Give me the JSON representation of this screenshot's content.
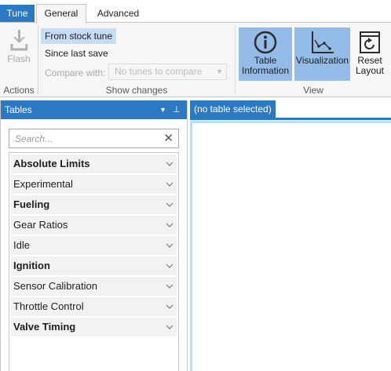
{
  "ribbon": {
    "tabs": {
      "tune": "Tune",
      "general": "General",
      "advanced": "Advanced"
    },
    "actions": {
      "flash_label": "Flash",
      "group_label": "Actions"
    },
    "show_changes": {
      "option_stock": "From stock tune",
      "option_last_save": "Since last save",
      "compare_label": "Compare with:",
      "compare_value": "No tunes to compare",
      "group_label": "Show changes"
    },
    "view": {
      "table_info_line1": "Table",
      "table_info_line2": "Information",
      "visualization": "Visualization",
      "reset_line1": "Reset",
      "reset_line2": "Layout",
      "group_label": "View"
    }
  },
  "tables_panel": {
    "title": "Tables",
    "search_placeholder": "Search...",
    "items": [
      {
        "label": "Absolute Limits",
        "bold": true
      },
      {
        "label": "Experimental",
        "bold": false
      },
      {
        "label": "Fueling",
        "bold": true
      },
      {
        "label": "Gear Ratios",
        "bold": false
      },
      {
        "label": "Idle",
        "bold": false
      },
      {
        "label": "Ignition",
        "bold": true
      },
      {
        "label": "Sensor Calibration",
        "bold": false
      },
      {
        "label": "Throttle Control",
        "bold": false
      },
      {
        "label": "Valve Timing",
        "bold": true
      }
    ]
  },
  "document": {
    "tab_label": "(no table selected)"
  },
  "colors": {
    "accent": "#2b79c2",
    "selection": "#c5dcf3",
    "active_button": "#93bde8"
  }
}
